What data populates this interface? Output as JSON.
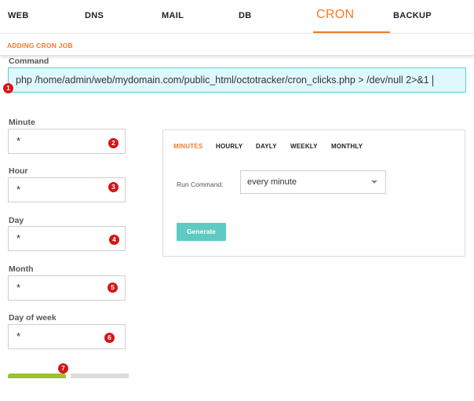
{
  "nav": {
    "items": [
      {
        "label": "WEB"
      },
      {
        "label": "DNS"
      },
      {
        "label": "MAIL"
      },
      {
        "label": "DB"
      },
      {
        "label": "CRON"
      },
      {
        "label": "BACKUP"
      }
    ],
    "active": "CRON"
  },
  "subheader": {
    "title": "ADDING CRON JOB"
  },
  "form": {
    "command": {
      "label": "Command",
      "value": "php /home/admin/web/mydomain.com/public_html/octotracker/cron_clicks.php > /dev/null 2>&1"
    },
    "minute": {
      "label": "Minute",
      "value": "*"
    },
    "hour": {
      "label": "Hour",
      "value": "*"
    },
    "day": {
      "label": "Day",
      "value": "*"
    },
    "month": {
      "label": "Month",
      "value": "*"
    },
    "day_of_week": {
      "label": "Day of week",
      "value": "*"
    }
  },
  "badges": [
    "1",
    "2",
    "3",
    "4",
    "5",
    "6",
    "7"
  ],
  "generator": {
    "tabs": [
      {
        "label": "MINUTES"
      },
      {
        "label": "HOURLY"
      },
      {
        "label": "DAYLY"
      },
      {
        "label": "WEEKLY"
      },
      {
        "label": "MONTHLY"
      }
    ],
    "active_tab": "MINUTES",
    "run_label": "Run Command:",
    "run_value": "every minute",
    "button_label": "Generate"
  },
  "colors": {
    "accent": "#f57a2a",
    "command_bg": "#dff8fd",
    "command_border": "#5ec9de",
    "badge": "#d81414",
    "generate_button": "#5fcac2",
    "save_bar": "#9bc132",
    "back_bar": "#dcdcdc"
  }
}
